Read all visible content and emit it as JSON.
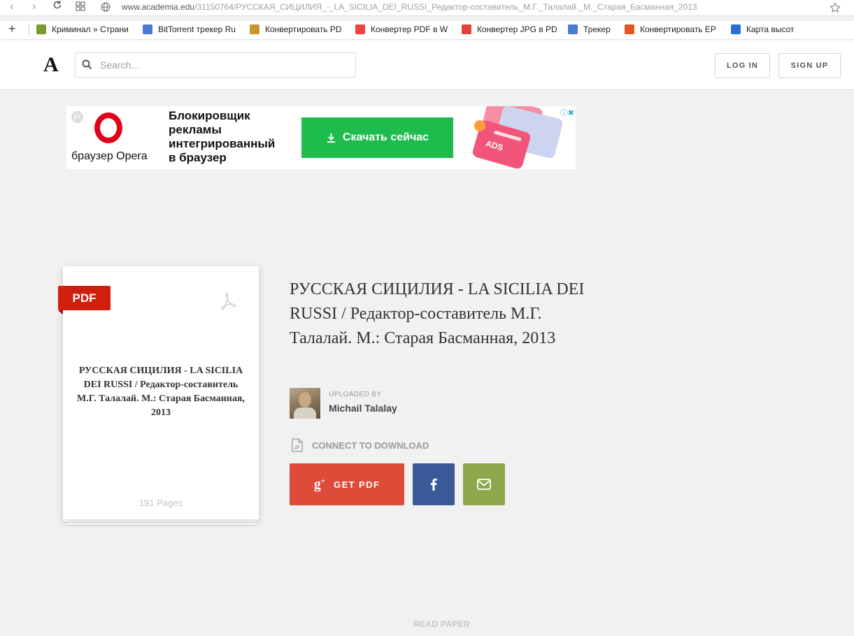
{
  "browser": {
    "url_host": "www.academia.edu",
    "url_path": "/31150764/РУССКАЯ_СИЦИЛИЯ_-_LA_SICILIA_DEI_RUSSI_Редактор-составитель_М.Г._Талалай._М._Старая_Басманная_2013",
    "bookmarks": [
      {
        "label": "Криминал » Страни",
        "icon": "tf-icon",
        "color": "#7a9a2e"
      },
      {
        "label": "BitTorrent трекер Ru",
        "icon": "tracker-icon",
        "color": "#4a7bd0"
      },
      {
        "label": "Конвертировать PD",
        "icon": "convert-icon",
        "color": "#c8962b"
      },
      {
        "label": "Конвертер PDF в W",
        "icon": "windows-icon",
        "color": "#e44"
      },
      {
        "label": "Конвертер JPG в PD",
        "icon": "pdf-icon",
        "color": "#e0443c"
      },
      {
        "label": "Трекер",
        "icon": "tracker-icon",
        "color": "#4a7bd0"
      },
      {
        "label": "Конвертировать EP",
        "icon": "refresh-icon",
        "color": "#e2572a"
      },
      {
        "label": "Карта высот",
        "icon": "g-icon",
        "color": "#2a6fd6"
      }
    ]
  },
  "header": {
    "logo": "A",
    "search_placeholder": "Search...",
    "login": "LOG IN",
    "signup": "SIGN UP"
  },
  "ad": {
    "age": "0+",
    "brand": "браузер Opera",
    "text_lines": [
      "Блокировщик",
      "рекламы",
      "интегрированный",
      "в браузер"
    ],
    "cta": "Скачать сейчас",
    "badge": "ADS"
  },
  "document": {
    "ribbon": "PDF",
    "card_title": "РУССКАЯ СИЦИЛИЯ - LA SICILIA DEI RUSSI / Редактор-составитель М.Г. Талалай. М.: Старая Басманная, 2013",
    "pages": "191 Pages",
    "title": "РУССКАЯ СИЦИЛИЯ - LA SICILIA DEI RUSSI / Редактор-составитель М.Г. Талалай. М.: Старая Басманная, 2013",
    "uploaded_by_label": "UPLOADED BY",
    "uploader": "Michail Talalay",
    "connect": "CONNECT TO DOWNLOAD",
    "get_pdf": "GET PDF",
    "read_paper": "READ PAPER"
  },
  "colors": {
    "google": "#dd4b39",
    "facebook": "#3b5998",
    "email": "#8fa84b",
    "ribbon": "#d11f0d",
    "cta": "#1fbb4c"
  }
}
